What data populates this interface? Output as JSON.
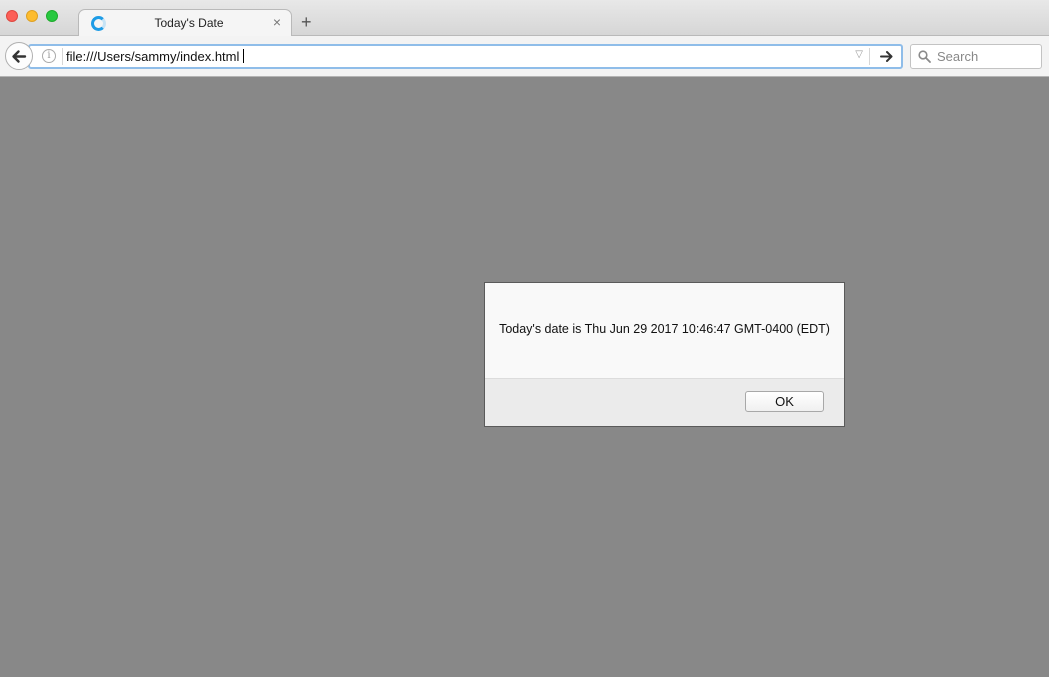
{
  "window": {
    "tab_title": "Today's Date",
    "tab_close_glyph": "×",
    "new_tab_glyph": "+"
  },
  "toolbar": {
    "back_icon": "back-arrow-icon",
    "info_glyph": "i",
    "url": "file:///Users/sammy/index.html",
    "dropdown_glyph": "▽",
    "go_icon": "forward-arrow-icon",
    "search_placeholder": "Search"
  },
  "dialog": {
    "message": "Today's date is Thu Jun 29 2017 10:46:47 GMT-0400 (EDT)",
    "ok_label": "OK"
  },
  "colors": {
    "page_background": "#888888",
    "url_focus_border": "#8fbde9",
    "close_light": "#fc5f57",
    "minimize_light": "#fdbc2e",
    "maximize_light": "#28c840"
  }
}
